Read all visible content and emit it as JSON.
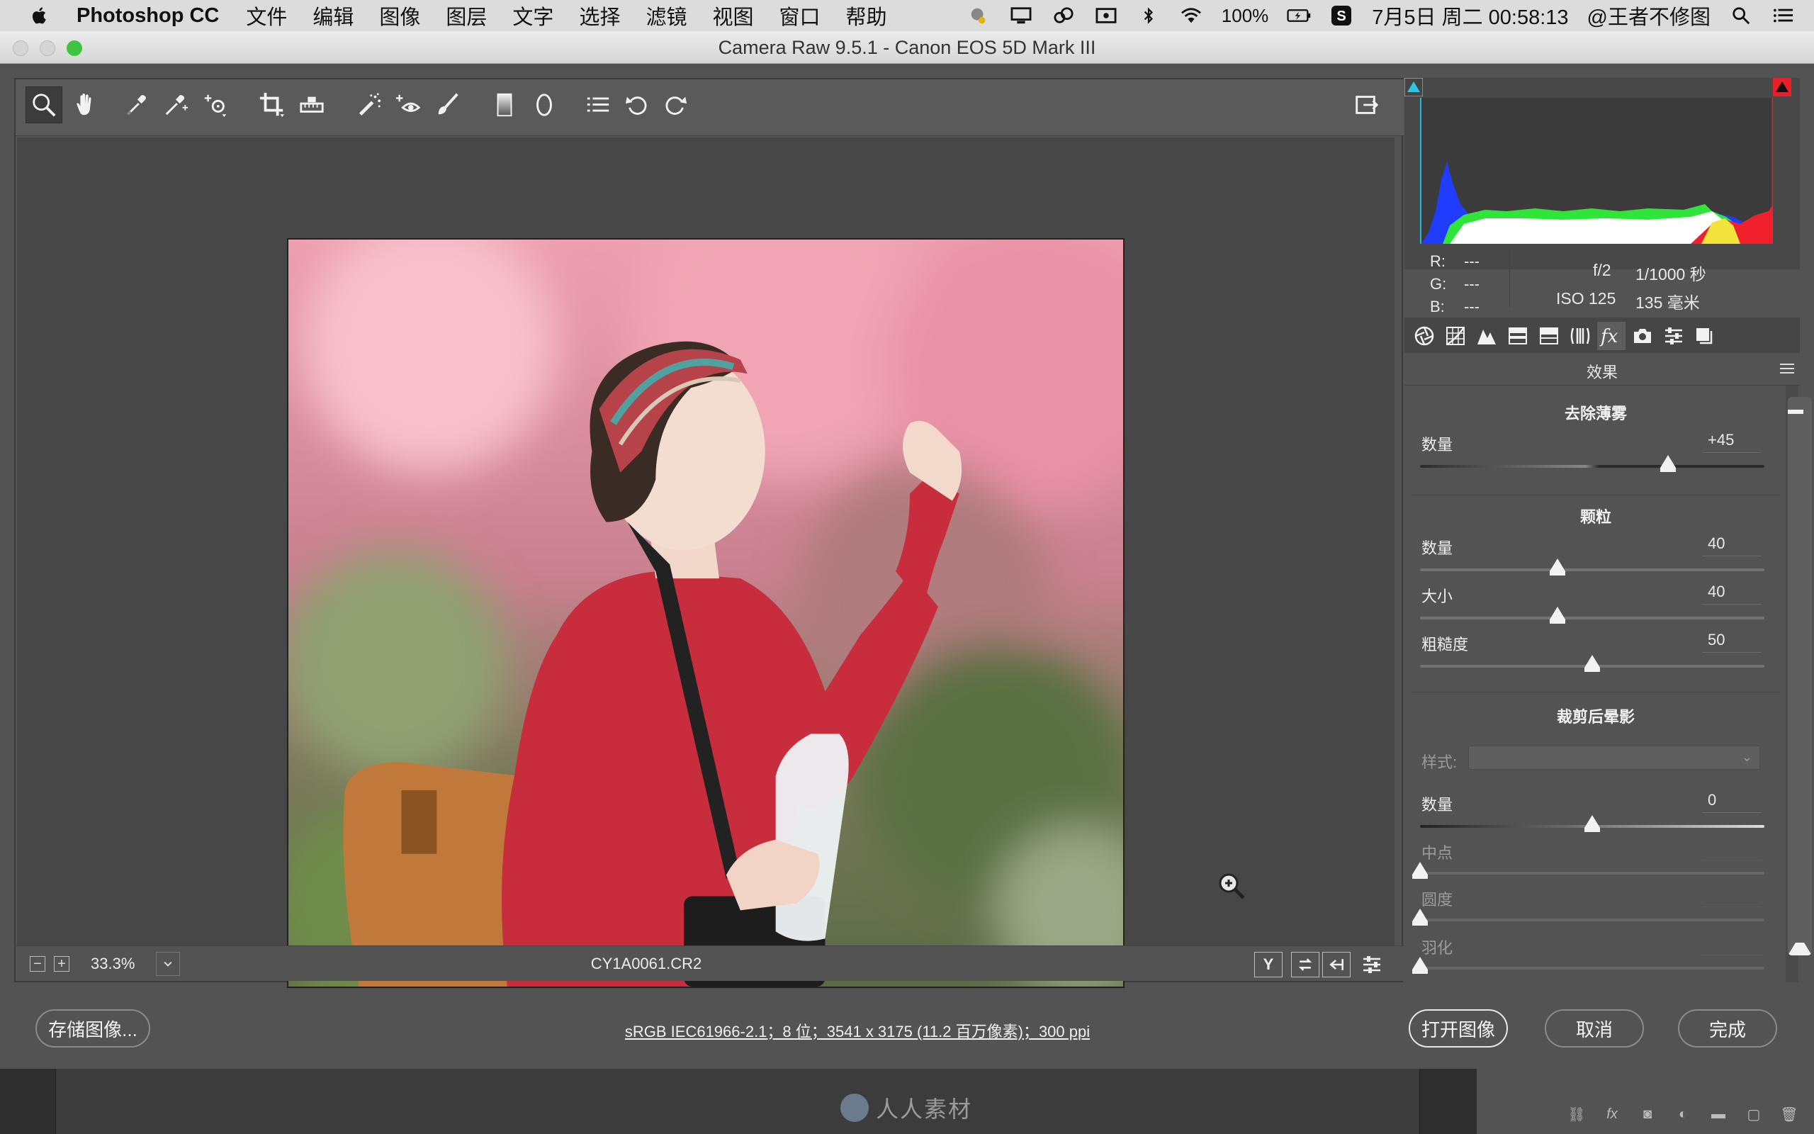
{
  "menubar": {
    "app_name": "Photoshop CC",
    "menus": [
      "文件",
      "编辑",
      "图像",
      "图层",
      "文字",
      "选择",
      "滤镜",
      "视图",
      "窗口",
      "帮助"
    ],
    "battery": "100%",
    "datetime": "7月5日 周二 00:58:13",
    "user": "@王者不修图"
  },
  "window": {
    "title": "Camera Raw 9.5.1 -  Canon EOS 5D Mark III"
  },
  "toolbar": {
    "tools": [
      "zoom-tool",
      "hand-tool",
      "white-balance-tool",
      "color-sampler-tool",
      "targeted-adjustment-tool",
      "crop-tool",
      "straighten-tool",
      "spot-removal-tool",
      "red-eye-removal-tool",
      "adjustment-brush",
      "graduated-filter",
      "radial-filter",
      "open-preferences",
      "rotate-ccw",
      "rotate-cw"
    ],
    "active_tool": "zoom-tool"
  },
  "status": {
    "zoom": "33.3%",
    "filename": "CY1A0061.CR2",
    "view_toggle": "Y"
  },
  "info": {
    "r_label": "R:",
    "r_value": "---",
    "g_label": "G:",
    "g_value": "---",
    "b_label": "B:",
    "b_value": "---",
    "aperture": "f/2",
    "shutter": "1/1000 秒",
    "iso": "ISO 125",
    "focal": "135 毫米"
  },
  "panel": {
    "title": "效果",
    "dehaze": {
      "title": "去除薄雾",
      "amount_label": "数量",
      "amount_value": "+45",
      "amount_norm": 0.72
    },
    "grain": {
      "title": "颗粒",
      "amount_label": "数量",
      "amount_value": "40",
      "amount_norm": 0.4,
      "size_label": "大小",
      "size_value": "40",
      "size_norm": 0.4,
      "roughness_label": "粗糙度",
      "roughness_value": "50",
      "roughness_norm": 0.5
    },
    "vignette": {
      "title": "裁剪后晕影",
      "style_label": "样式:",
      "amount_label": "数量",
      "amount_value": "0",
      "amount_norm": 0.5,
      "midpoint_label": "中点",
      "roundness_label": "圆度",
      "feather_label": "羽化"
    }
  },
  "bottom": {
    "save_label": "存储图像...",
    "workflow": "sRGB IEC61966-2.1；8 位；3541 x 3175 (11.2 百万像素)；300 ppi",
    "open_label": "打开图像",
    "cancel_label": "取消",
    "done_label": "完成"
  },
  "watermark": "人人素材",
  "colors": {
    "accent_shadow_clip": "#29c9e6",
    "accent_highlight_clip": "#e8202a",
    "window_bg": "#535353"
  }
}
